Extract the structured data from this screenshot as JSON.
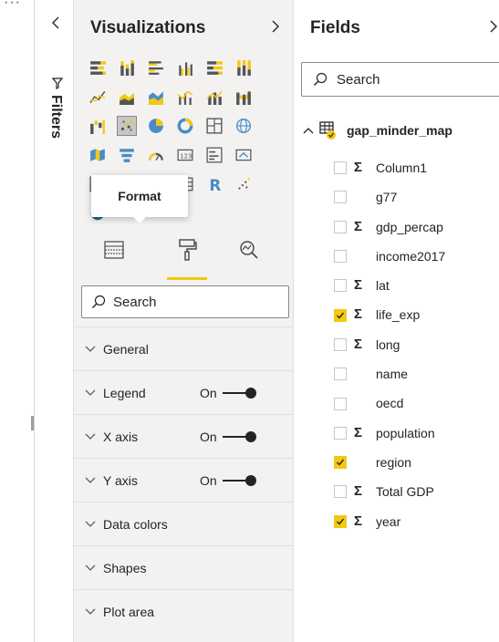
{
  "filters": {
    "label": "Filters"
  },
  "visualizations": {
    "title": "Visualizations",
    "tooltip": "Format",
    "search_placeholder": "Search",
    "icons": [
      "stacked-bar-icon",
      "stacked-column-icon",
      "clustered-bar-icon",
      "clustered-column-icon",
      "100-stacked-bar-icon",
      "100-stacked-column-icon",
      "line-chart-icon",
      "area-chart-icon",
      "stacked-area-icon",
      "line-clustered-column-icon",
      "line-stacked-column-icon",
      "ribbon-chart-icon",
      "waterfall-icon",
      "scatter-chart-icon",
      "pie-chart-icon",
      "donut-chart-icon",
      "treemap-icon",
      "map-icon",
      "filled-map-icon",
      "funnel-icon",
      "gauge-icon",
      "card-icon",
      "multi-row-card-icon",
      "kpi-icon",
      "slicer-icon",
      "table-icon",
      "matrix-icon",
      "matrix-icon-2",
      "r-visual-icon",
      "python-visual-icon",
      "arcgis-icon",
      "more-visuals-icon"
    ],
    "tabs": [
      "fields-tab-icon",
      "format-tab-icon",
      "analytics-tab-icon"
    ],
    "sections": [
      {
        "label": "General",
        "on_label": ""
      },
      {
        "label": "Legend",
        "on_label": "On"
      },
      {
        "label": "X axis",
        "on_label": "On"
      },
      {
        "label": "Y axis",
        "on_label": "On"
      },
      {
        "label": "Data colors",
        "on_label": ""
      },
      {
        "label": "Shapes",
        "on_label": ""
      },
      {
        "label": "Plot area",
        "on_label": ""
      }
    ]
  },
  "fields": {
    "title": "Fields",
    "search_placeholder": "Search",
    "table_name": "gap_minder_map",
    "items": [
      {
        "name": "Column1",
        "sigma": true,
        "checked": false
      },
      {
        "name": "g77",
        "sigma": false,
        "checked": false
      },
      {
        "name": "gdp_percap",
        "sigma": true,
        "checked": false
      },
      {
        "name": "income2017",
        "sigma": false,
        "checked": false
      },
      {
        "name": "lat",
        "sigma": true,
        "checked": false
      },
      {
        "name": "life_exp",
        "sigma": true,
        "checked": true
      },
      {
        "name": "long",
        "sigma": true,
        "checked": false
      },
      {
        "name": "name",
        "sigma": false,
        "checked": false
      },
      {
        "name": "oecd",
        "sigma": false,
        "checked": false
      },
      {
        "name": "population",
        "sigma": true,
        "checked": false
      },
      {
        "name": "region",
        "sigma": false,
        "checked": true
      },
      {
        "name": "Total GDP",
        "sigma": true,
        "checked": false
      },
      {
        "name": "year",
        "sigma": true,
        "checked": true
      }
    ]
  },
  "colors": {
    "accent": "#f2c811",
    "pane_bg": "#f3f2f1",
    "text": "#252423"
  }
}
